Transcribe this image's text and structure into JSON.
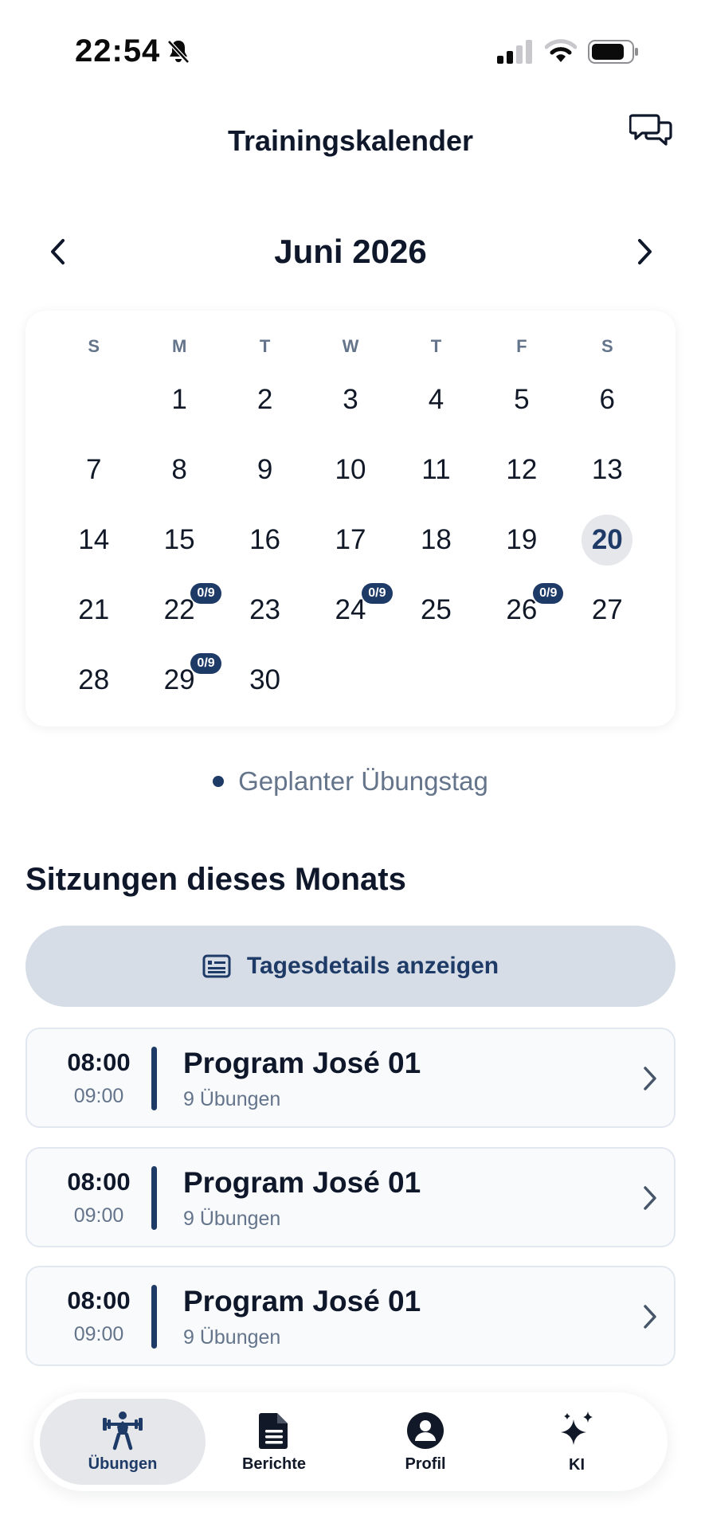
{
  "status_bar": {
    "time": "22:54"
  },
  "header": {
    "title": "Trainingskalender"
  },
  "calendar": {
    "month_label": "Juni 2026",
    "weekdays": [
      "S",
      "M",
      "T",
      "W",
      "T",
      "F",
      "S"
    ],
    "leading_blanks": 1,
    "days": [
      "1",
      "2",
      "3",
      "4",
      "5",
      "6",
      "7",
      "8",
      "9",
      "10",
      "11",
      "12",
      "13",
      "14",
      "15",
      "16",
      "17",
      "18",
      "19",
      "20",
      "21",
      "22",
      "23",
      "24",
      "25",
      "26",
      "27",
      "28",
      "29",
      "30"
    ],
    "today": "20",
    "badges": {
      "22": "0/9",
      "24": "0/9",
      "26": "0/9",
      "29": "0/9"
    }
  },
  "legend": {
    "label": "Geplanter Übungstag"
  },
  "sessions_section": {
    "title": "Sitzungen dieses Monats",
    "details_button": "Tagesdetails anzeigen",
    "sessions": [
      {
        "start": "08:00",
        "end": "09:00",
        "name": "Program José 01",
        "meta": "9 Übungen"
      },
      {
        "start": "08:00",
        "end": "09:00",
        "name": "Program José 01",
        "meta": "9 Übungen"
      },
      {
        "start": "08:00",
        "end": "09:00",
        "name": "Program José 01",
        "meta": "9 Übungen"
      }
    ]
  },
  "tabs": [
    {
      "label": "Übungen",
      "icon": "weightlifter-icon",
      "active": true
    },
    {
      "label": "Berichte",
      "icon": "document-icon",
      "active": false
    },
    {
      "label": "Profil",
      "icon": "person-icon",
      "active": false
    },
    {
      "label": "KI",
      "icon": "sparkles-icon",
      "active": false
    }
  ],
  "colors": {
    "accent": "#1e3a66",
    "muted": "#64748b",
    "button_bg": "#d6dde6"
  }
}
